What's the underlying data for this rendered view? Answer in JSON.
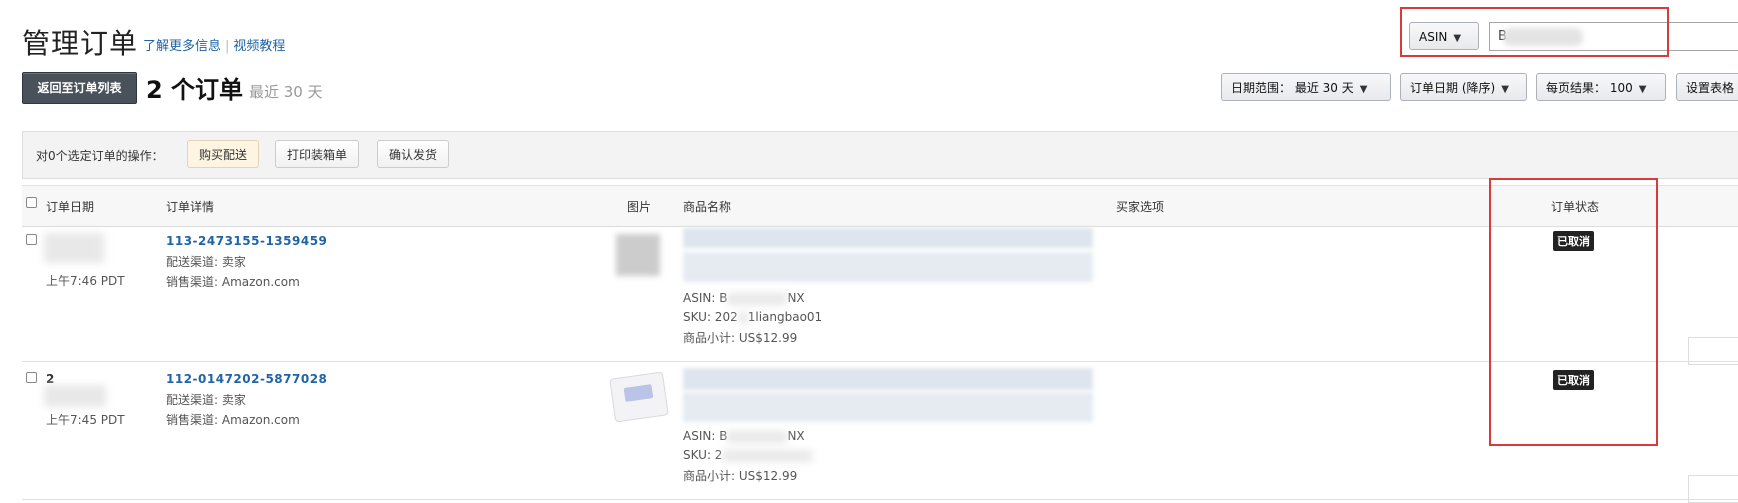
{
  "header": {
    "title": "管理订单",
    "link_more_info": "了解更多信息",
    "link_video": "视频教程",
    "back_button": "返回至订单列表",
    "order_count": "2 个订单",
    "range_hint": "最近 30 天"
  },
  "search": {
    "field_select": "ASIN",
    "input_value": "B"
  },
  "controls": {
    "date_range": "日期范围：  最近 30 天",
    "sort": "订单日期 (降序)",
    "per_page": "每页结果：  100",
    "settings": "设置表格"
  },
  "actions": {
    "label": "对0个选定订单的操作：",
    "buy_shipping": "购买配送",
    "print_packing": "打印装箱单",
    "confirm_ship": "确认发货"
  },
  "table": {
    "headers": {
      "order_date": "订单日期",
      "order_details": "订单详情",
      "image": "图片",
      "product_name": "商品名称",
      "buyer_options": "买家选项",
      "order_status": "订单状态"
    },
    "rows": [
      {
        "time": "上午7:46 PDT",
        "order_id": "113-2473155-1359459",
        "fulfillment": "配送渠道: 卖家",
        "sales_channel": "销售渠道: Amazon.com",
        "asin": "ASIN: B",
        "asin_tail": "NX",
        "sku": "SKU: 202",
        "sku_tail": "1liangbao01",
        "subtotal": "商品小计: US$12.99",
        "status": "已取消"
      },
      {
        "date_prefix": "2",
        "time": "上午7:45 PDT",
        "order_id": "112-0147202-5877028",
        "fulfillment": "配送渠道: 卖家",
        "sales_channel": "销售渠道: Amazon.com",
        "asin": "ASIN: B",
        "asin_tail": "NX",
        "sku": "SKU: 2",
        "subtotal": "商品小计: US$12.99",
        "status": "已取消"
      }
    ]
  },
  "colors": {
    "link": "#1f64a7",
    "annotation_red": "#d93b3b",
    "badge_bg": "#222222"
  }
}
